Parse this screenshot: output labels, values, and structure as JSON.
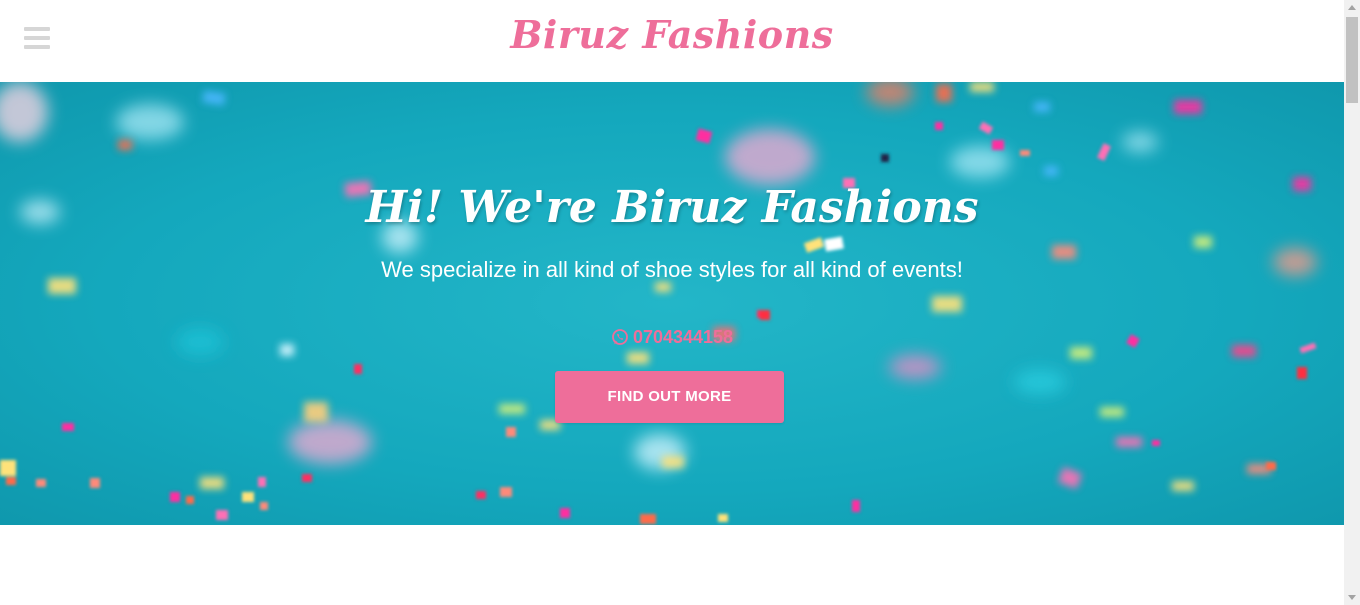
{
  "navbar": {
    "brand": "Biruz Fashions",
    "menu_icon": "hamburger-menu-icon"
  },
  "hero": {
    "title": "Hi! We're Biruz Fashions",
    "subtitle": "We specialize in all kind of shoe styles for all kind of events!",
    "phone": "0704344158",
    "phone_icon": "whatsapp-icon",
    "cta_label": "FIND OUT MORE",
    "background_image": "confetti-on-teal-image"
  },
  "colors": {
    "accent": "#ee6e9a",
    "hero_background": "#14a8bd",
    "text_light": "#ffffff"
  }
}
